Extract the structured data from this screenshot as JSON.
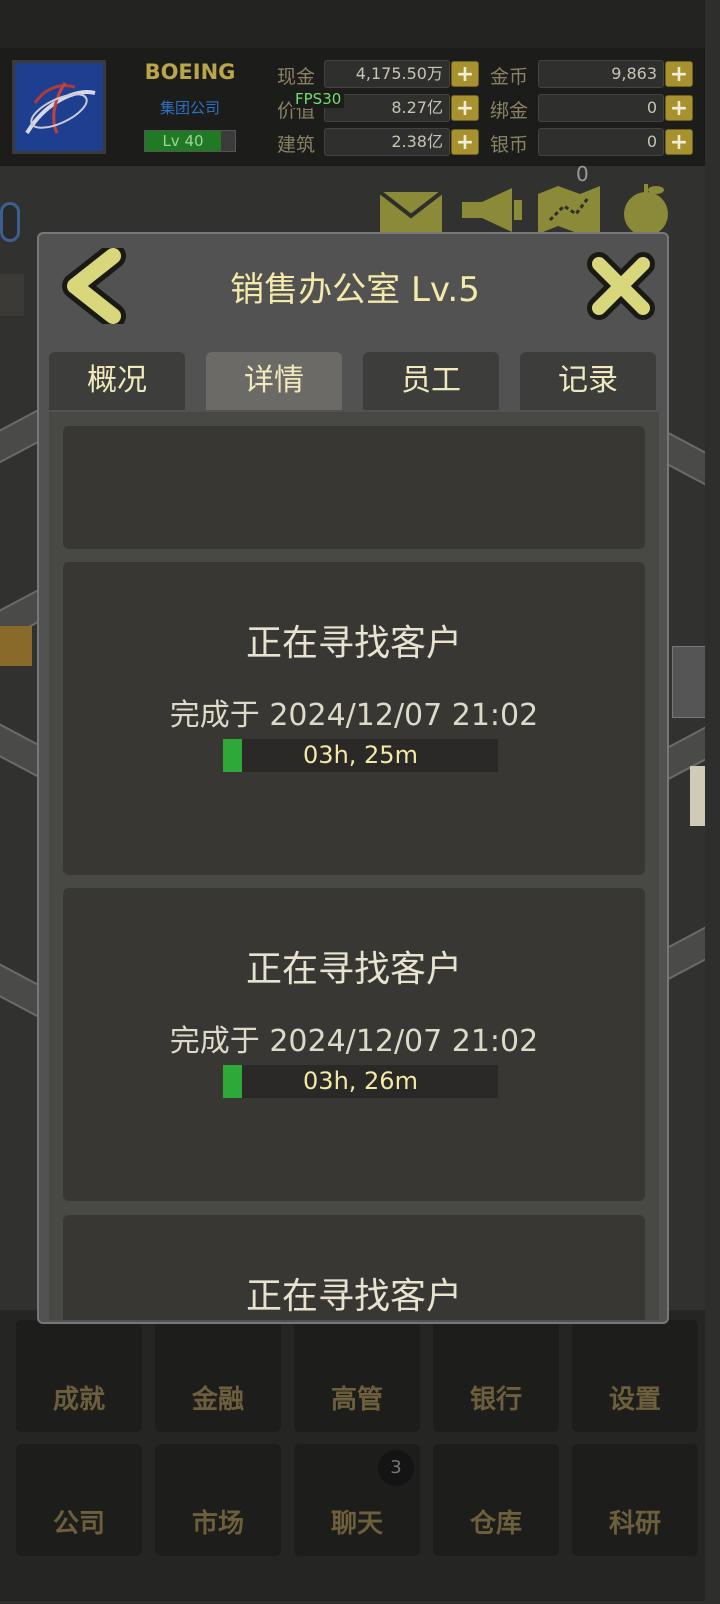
{
  "header": {
    "company_name": "BOEING",
    "company_type": "集团公司",
    "level": "Lv 40",
    "fps": "FPS30",
    "resources": [
      {
        "label": "现金",
        "value": "4,175.50万"
      },
      {
        "label": "价值",
        "value": "8.27亿"
      },
      {
        "label": "建筑",
        "value": "2.38亿"
      },
      {
        "label": "金币",
        "value": "9,863"
      },
      {
        "label": "绑金",
        "value": "0"
      },
      {
        "label": "银币",
        "value": "0"
      }
    ],
    "plus_symbol": "+",
    "map_badge": "0"
  },
  "toolbar_icons": [
    "envelope-icon",
    "megaphone-icon",
    "map-icon",
    "apple-icon"
  ],
  "modal": {
    "title": "销售办公室 Lv.5",
    "tabs": [
      {
        "label": "概况",
        "active": false
      },
      {
        "label": "详情",
        "active": true
      },
      {
        "label": "员工",
        "active": false
      },
      {
        "label": "记录",
        "active": false
      }
    ],
    "tasks": [
      {
        "title": "正在寻找客户",
        "complete": "完成于 2024/12/07 21:02",
        "remaining": "03h, 25m",
        "progress": 0.07
      },
      {
        "title": "正在寻找客户",
        "complete": "完成于 2024/12/07 21:02",
        "remaining": "03h, 26m",
        "progress": 0.07
      },
      {
        "title": "正在寻找客户"
      }
    ]
  },
  "bottom_menu": {
    "row1": [
      "成就",
      "金融",
      "高管",
      "银行",
      "设置"
    ],
    "row2": [
      "公司",
      "市场",
      "聊天",
      "仓库",
      "科研"
    ],
    "chat_badge": "3"
  },
  "colors": {
    "accent_gold": "#f3e9a9",
    "progress_green": "#2ea838",
    "plus_button": "#a7922f"
  }
}
